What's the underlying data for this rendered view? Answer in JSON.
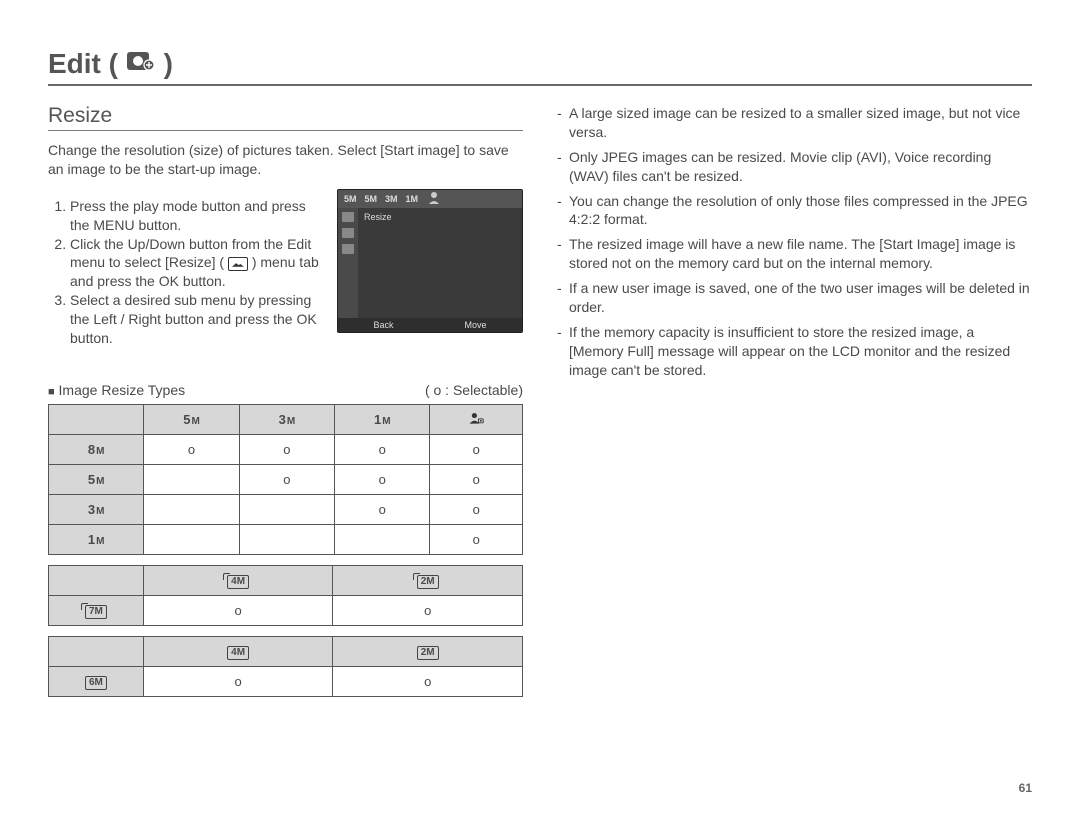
{
  "page_number": "61",
  "title": {
    "text": "Edit",
    "paren_open": "(",
    "paren_close": ")"
  },
  "left": {
    "subhead": "Resize",
    "intro": "Change the resolution (size) of pictures taken. Select [Start image] to save an image to be the start-up image.",
    "steps": [
      "Press the play mode button and press the MENU button.",
      "Click the Up/Down button from the Edit menu to select [Resize] (   ) menu tab and press the OK button.",
      "Select a desired sub menu by pressing the Left / Right button and press the OK button."
    ],
    "lcd": {
      "top_labels": [
        "5M",
        "5M",
        "3M",
        "1M"
      ],
      "menu_label": "Resize",
      "bottom_left": "Back",
      "bottom_right": "Move"
    },
    "types_label": "Image Resize Types",
    "selectable_label": "( o : Selectable)"
  },
  "right": {
    "bullets": [
      "A large sized image can be resized to a smaller sized image, but not vice versa.",
      "Only JPEG images can be resized. Movie clip (AVI), Voice recording (WAV) files can't be resized.",
      "You can change the resolution of only those files compressed in the JPEG 4:2:2 format.",
      "The resized image will have a new file name. The [Start Image] image is stored not on the memory card but on the internal memory.",
      "If a new user image is saved, one of the two user images will be deleted in order.",
      "If the memory capacity is insufficient to store the resized image, a [Memory Full] message will appear on the LCD monitor and the resized image can't be stored."
    ]
  },
  "chart_data": [
    {
      "type": "table",
      "title": "Standard aspect resize",
      "row_headers": [
        "8M",
        "5M",
        "3M",
        "1M"
      ],
      "col_headers": [
        "5M",
        "3M",
        "1M",
        "StartImage"
      ],
      "grid": [
        [
          "o",
          "o",
          "o",
          "o"
        ],
        [
          "",
          "o",
          "o",
          "o"
        ],
        [
          "",
          "",
          "o",
          "o"
        ],
        [
          "",
          "",
          "",
          "o"
        ]
      ]
    },
    {
      "type": "table",
      "title": "Wide aspect resize",
      "row_headers": [
        "7M"
      ],
      "col_headers": [
        "4M",
        "2M"
      ],
      "grid": [
        [
          "o",
          "o"
        ]
      ]
    },
    {
      "type": "table",
      "title": "Wide aspect resize 2",
      "row_headers": [
        "6M"
      ],
      "col_headers": [
        "4M",
        "2M"
      ],
      "grid": [
        [
          "o",
          "o"
        ]
      ]
    }
  ]
}
